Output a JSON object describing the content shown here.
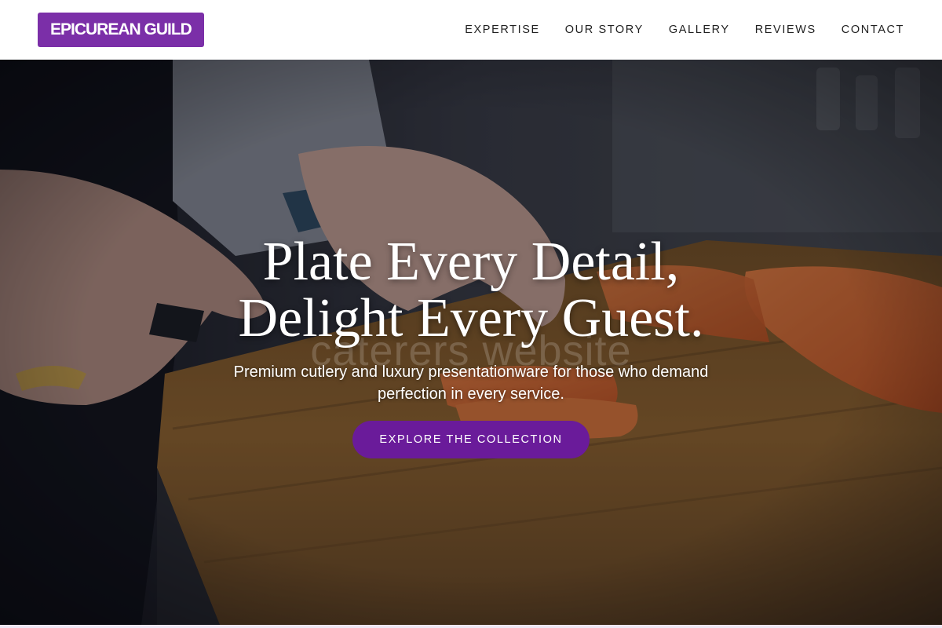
{
  "brand": {
    "name": "EPICUREAN GUILD",
    "color": "#7b2fa8"
  },
  "nav": {
    "items": [
      {
        "label": "EXPERTISE"
      },
      {
        "label": "OUR STORY"
      },
      {
        "label": "GALLERY"
      },
      {
        "label": "REVIEWS"
      },
      {
        "label": "CONTACT"
      }
    ]
  },
  "hero": {
    "title_line1": "Plate Every Detail,",
    "title_line2": "Delight Every Guest.",
    "watermark": "caterers website",
    "subtitle": "Premium cutlery and luxury presentationware for those who demand perfection in every service.",
    "cta_label": "EXPLORE THE COLLECTION",
    "cta_color": "#6a1b9a",
    "image_subject": "chef-slicing-salmon-on-wooden-board"
  }
}
